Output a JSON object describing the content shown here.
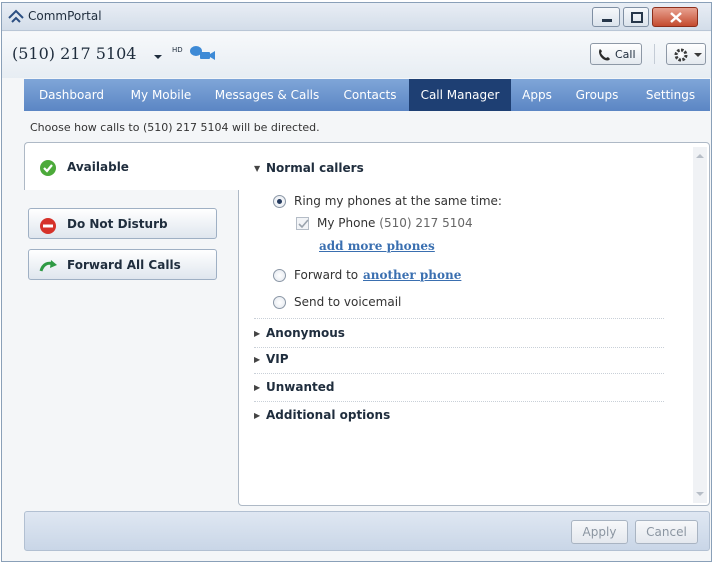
{
  "window": {
    "title": "CommPortal",
    "title_icon": "commportal-icon",
    "controls": [
      "minimize-icon",
      "maximize-icon",
      "close-icon"
    ]
  },
  "header": {
    "phone_number": "(510) 217 5104",
    "hd_label": "HD",
    "call_label": "Call"
  },
  "nav": {
    "items": [
      {
        "label": "Dashboard",
        "active": false
      },
      {
        "label": "My Mobile",
        "active": false
      },
      {
        "label": "Messages & Calls",
        "active": false
      },
      {
        "label": "Contacts",
        "active": false
      },
      {
        "label": "Call Manager",
        "active": true
      },
      {
        "label": "Apps",
        "active": false
      },
      {
        "label": "Groups",
        "active": false
      },
      {
        "label": "Settings",
        "active": false
      }
    ]
  },
  "hint": "Choose how calls to (510) 217 5104 will be directed.",
  "states": {
    "available": "Available",
    "do_not_disturb": "Do Not Disturb",
    "forward_all": "Forward All Calls"
  },
  "normal_callers": {
    "heading": "Normal callers",
    "ring_same_time": "Ring my phones at the same time:",
    "my_phone_label": "My Phone",
    "my_phone_number": "(510) 217 5104",
    "add_more_phones": "add more phones",
    "forward_to": "Forward to",
    "another_phone": "another phone",
    "send_voicemail": "Send to voicemail",
    "selected": "ring_same_time"
  },
  "sections": [
    "Anonymous",
    "VIP",
    "Unwanted",
    "Additional options"
  ],
  "footer": {
    "apply": "Apply",
    "cancel": "Cancel"
  },
  "colors": {
    "nav_bg": "#6a94cc",
    "nav_active": "#1e3f73",
    "link": "#3a6fb0",
    "available_green": "#4caa3a",
    "dnd_red": "#d6322a"
  }
}
